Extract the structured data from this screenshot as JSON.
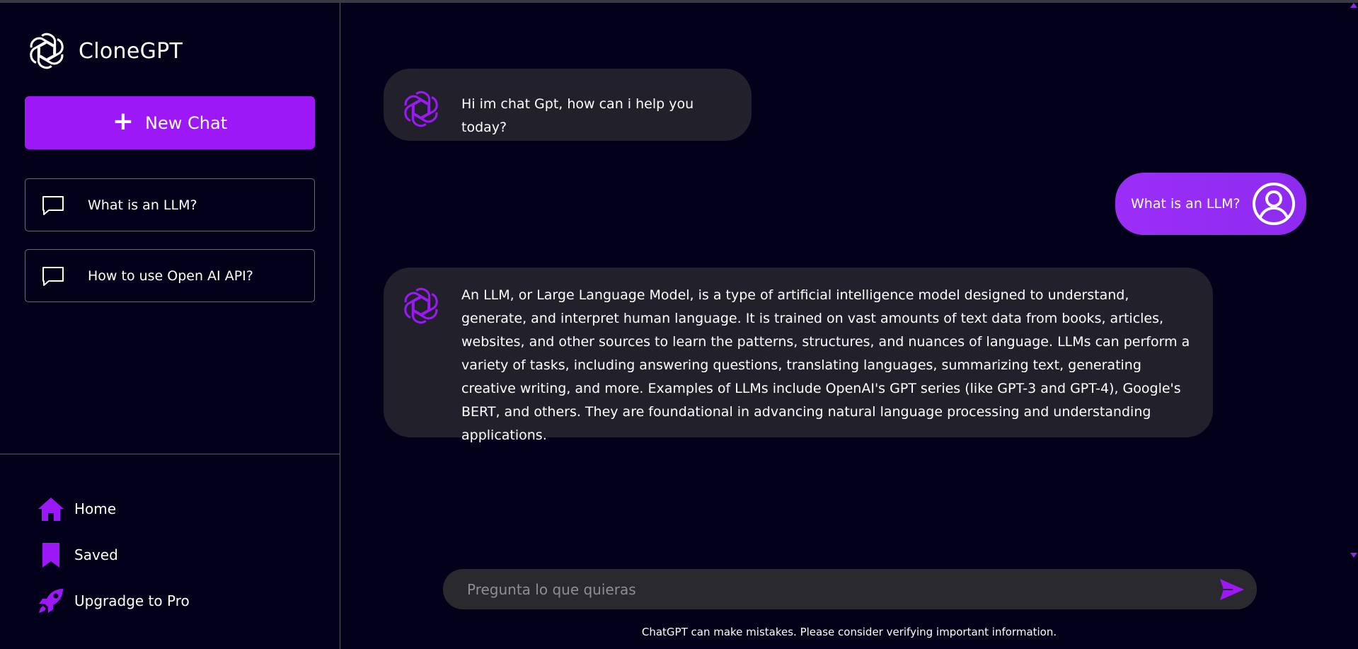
{
  "brand": {
    "title": "CloneGPT",
    "logo_icon": "openai-logo-icon"
  },
  "sidebar": {
    "new_chat_label": "New Chat",
    "history": [
      {
        "label": "What is an LLM?",
        "icon": "chat-bubble-icon"
      },
      {
        "label": "How to use Open AI API?",
        "icon": "chat-bubble-icon"
      }
    ],
    "nav": [
      {
        "label": "Home",
        "icon": "home-icon"
      },
      {
        "label": "Saved",
        "icon": "bookmark-icon"
      },
      {
        "label": "Upgradge to Pro",
        "icon": "rocket-icon"
      }
    ]
  },
  "messages": [
    {
      "role": "bot",
      "text": "Hi im chat Gpt, how can i help you today?"
    },
    {
      "role": "user",
      "text": "What is an LLM?"
    },
    {
      "role": "bot",
      "text": "An LLM, or Large Language Model, is a type of artificial intelligence model designed to understand, generate, and interpret human language. It is trained on vast amounts of text data from books, articles, websites, and other sources to learn the patterns, structures, and nuances of language. LLMs can perform a variety of tasks, including answering questions, translating languages, summarizing text, generating creative writing, and more. Examples of LLMs include OpenAI's GPT series (like GPT-3 and GPT-4), Google's BERT, and others. They are foundational in advancing natural language processing and understanding applications."
    }
  ],
  "composer": {
    "placeholder": "Pregunta lo que quieras",
    "value": ""
  },
  "disclaimer": "ChatGPT can make mistakes. Please consider verifying important information.",
  "colors": {
    "background": "#03001a",
    "accent": "#9c18f6",
    "bubble_bot": "#22202b",
    "composer": "#2a292e"
  }
}
